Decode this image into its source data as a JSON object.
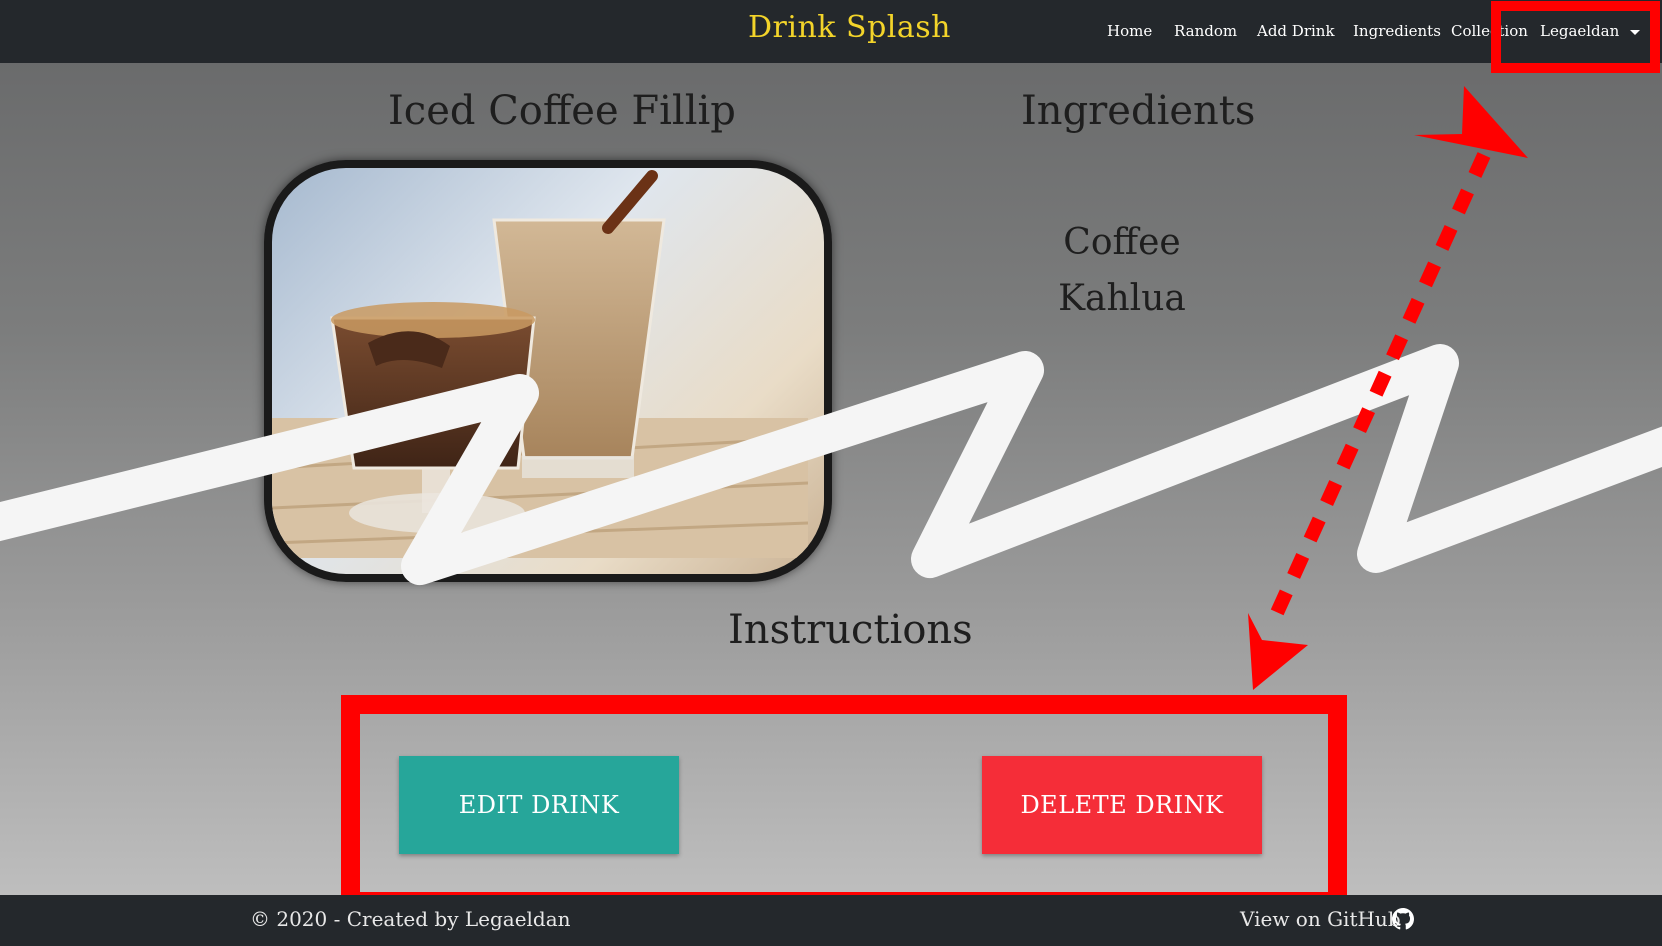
{
  "navbar": {
    "brand": "Drink Splash",
    "links": [
      "Home",
      "Random",
      "Add Drink",
      "Ingredients",
      "Collection"
    ],
    "user": "Legaeldan"
  },
  "drink": {
    "name": "Iced Coffee Fillip",
    "ingredients_title": "Ingredients",
    "ingredients": [
      "Coffee",
      "Kahlua"
    ],
    "instructions_title": "Instructions"
  },
  "actions": {
    "edit_label": "EDIT DRINK",
    "delete_label": "DELETE DRINK"
  },
  "footer": {
    "copyright": "© 2020 - Created by Legaeldan",
    "github": "View on GitHub"
  },
  "colors": {
    "navbar": "#24282c",
    "brand": "#f3d42a",
    "edit_button": "#26a69a",
    "delete_button": "#f52d38",
    "annotation": "#ff0000"
  }
}
